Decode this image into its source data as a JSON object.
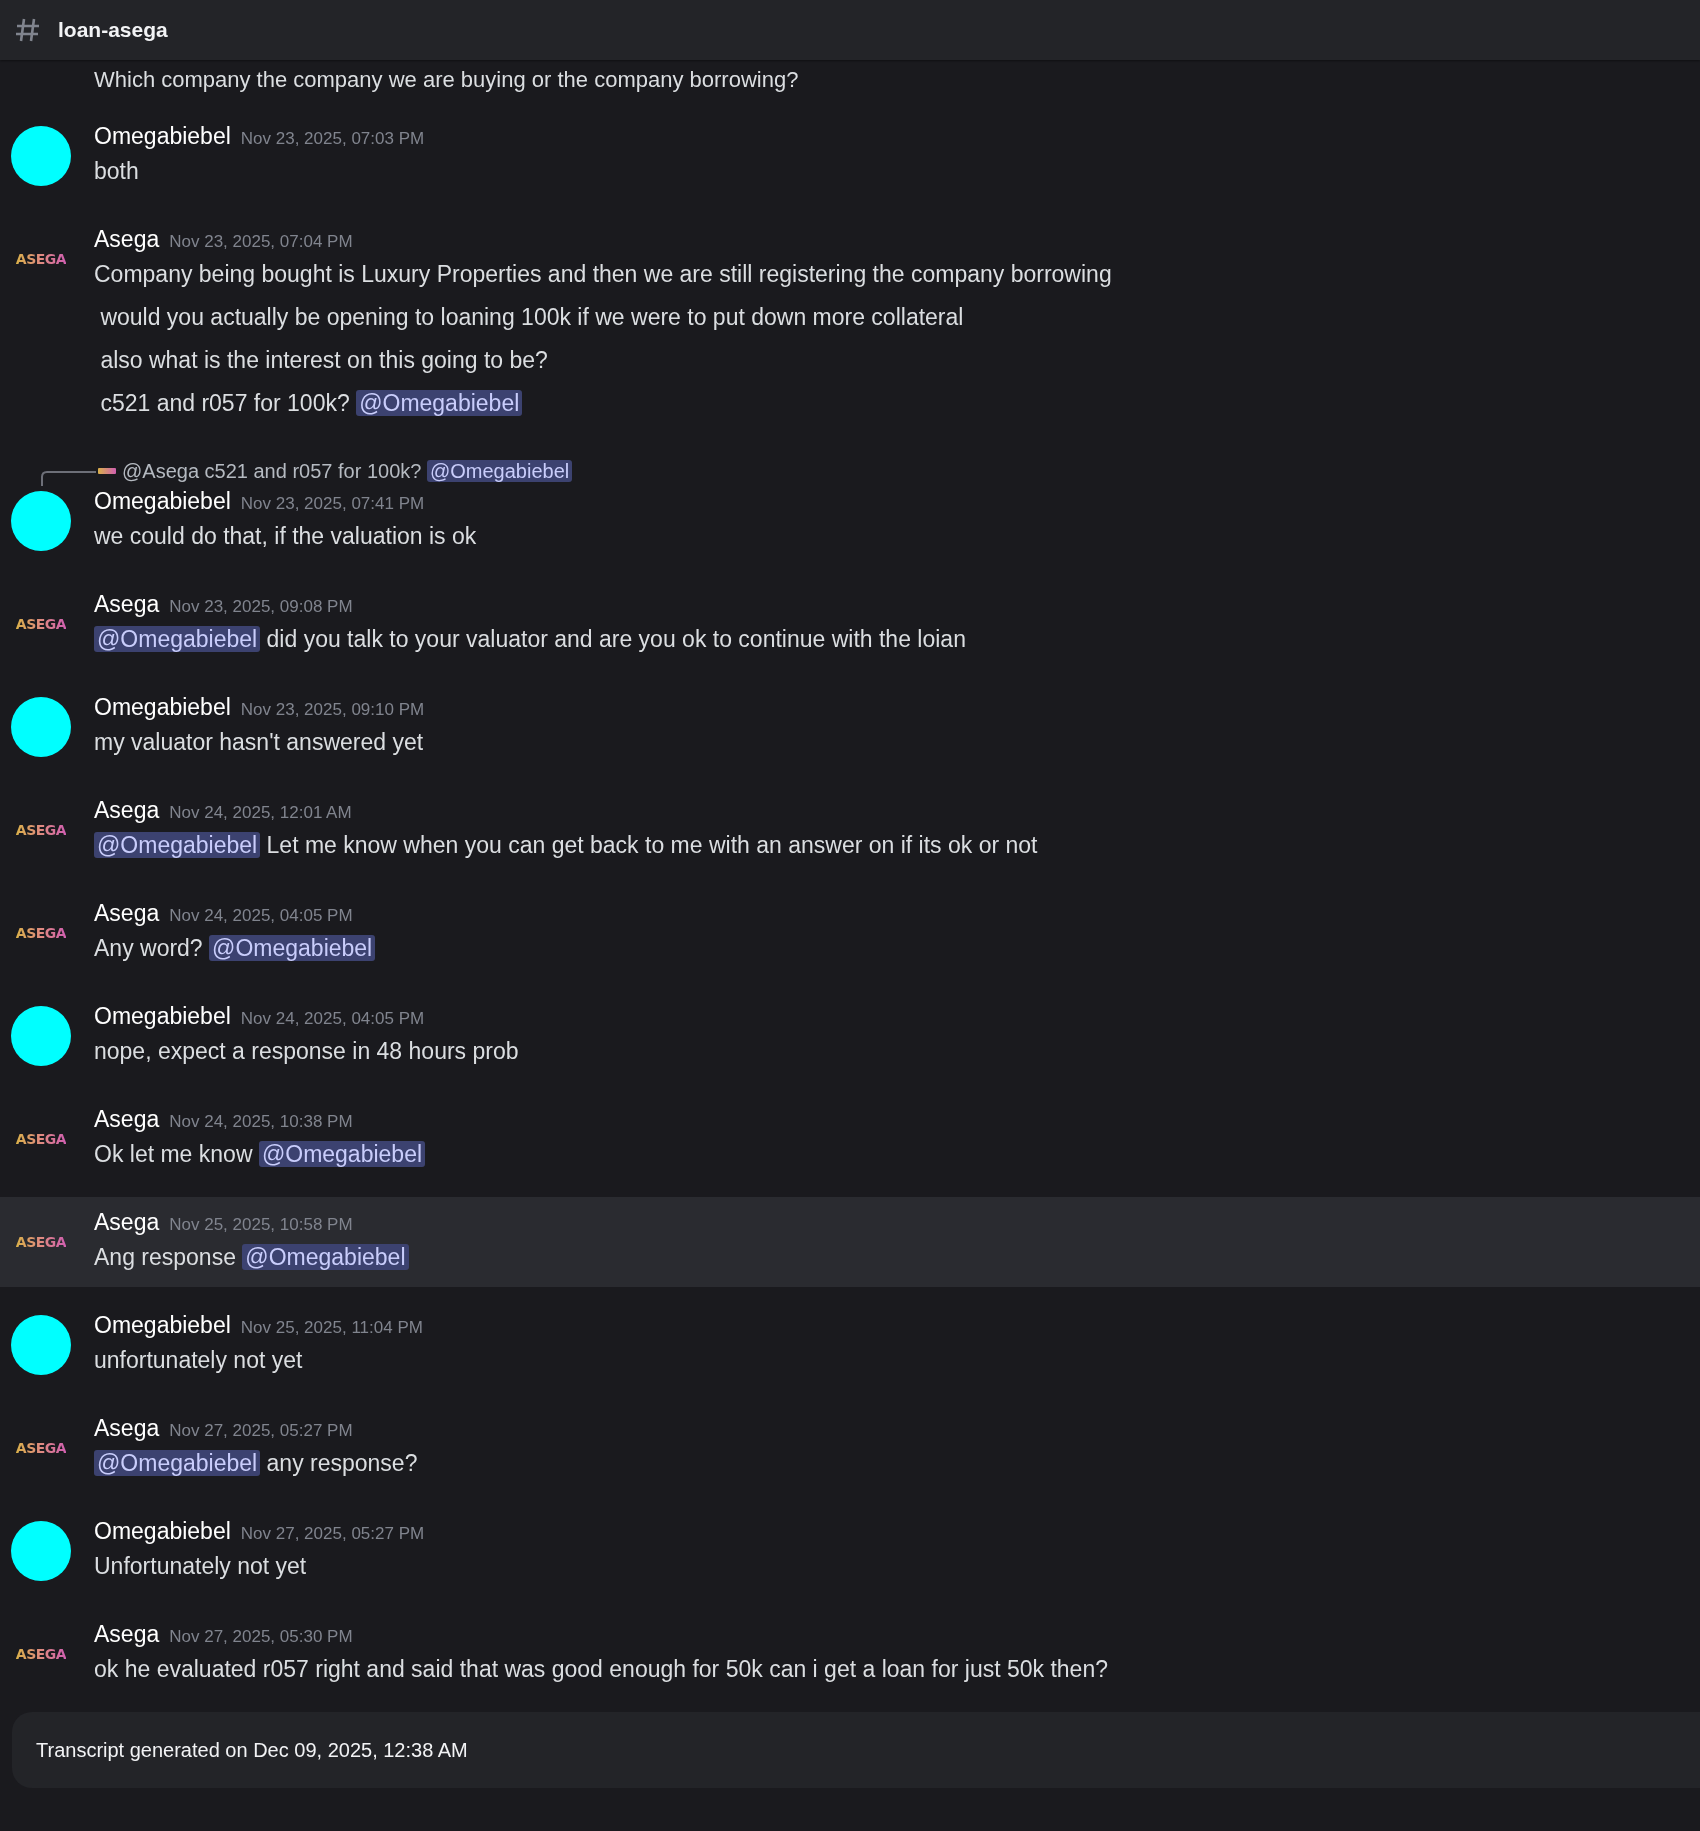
{
  "channel": {
    "name": "loan-asega"
  },
  "partial_message": "Which company the company we are buying or the company borrowing?",
  "messages": [
    {
      "author": "Omegabiebel",
      "kind": "circle",
      "timestamp": "Nov 23, 2025, 07:03 PM",
      "highlighted": false,
      "lines": [
        [
          {
            "kind": "text",
            "text": "both"
          }
        ]
      ]
    },
    {
      "author": "Asega",
      "kind": "logo",
      "avatar_text": "ASEGA",
      "timestamp": "Nov 23, 2025, 07:04 PM",
      "highlighted": false,
      "lines": [
        [
          {
            "kind": "text",
            "text": "Company being bought is Luxury Properties and then we are still registering the company borrowing"
          }
        ],
        [
          {
            "kind": "text",
            "text": " would you actually be opening to loaning 100k if we were to put down more collateral"
          }
        ],
        [
          {
            "kind": "text",
            "text": " also what is the interest on this going to be?"
          }
        ],
        [
          {
            "kind": "text",
            "text": " c521 and r057 for 100k? "
          },
          {
            "kind": "mention",
            "text": "@Omegabiebel"
          }
        ]
      ]
    },
    {
      "author": "Omegabiebel",
      "kind": "circle",
      "timestamp": "Nov 23, 2025, 07:41 PM",
      "highlighted": false,
      "reply": [
        {
          "kind": "text",
          "text": "@Asega c521 and r057 for 100k? "
        },
        {
          "kind": "mention",
          "text": "@Omegabiebel"
        }
      ],
      "lines": [
        [
          {
            "kind": "text",
            "text": "we could do that, if the valuation is ok"
          }
        ]
      ]
    },
    {
      "author": "Asega",
      "kind": "logo",
      "avatar_text": "ASEGA",
      "timestamp": "Nov 23, 2025, 09:08 PM",
      "highlighted": false,
      "lines": [
        [
          {
            "kind": "mention",
            "text": "@Omegabiebel"
          },
          {
            "kind": "text",
            "text": " did you talk to your valuator and are you ok to continue with the loian"
          }
        ]
      ]
    },
    {
      "author": "Omegabiebel",
      "kind": "circle",
      "timestamp": "Nov 23, 2025, 09:10 PM",
      "highlighted": false,
      "lines": [
        [
          {
            "kind": "text",
            "text": "my valuator hasn't answered yet"
          }
        ]
      ]
    },
    {
      "author": "Asega",
      "kind": "logo",
      "avatar_text": "ASEGA",
      "timestamp": "Nov 24, 2025, 12:01 AM",
      "highlighted": false,
      "lines": [
        [
          {
            "kind": "mention",
            "text": "@Omegabiebel"
          },
          {
            "kind": "text",
            "text": " Let me know when you can get back to me with an answer on if its ok or not"
          }
        ]
      ]
    },
    {
      "author": "Asega",
      "kind": "logo",
      "avatar_text": "ASEGA",
      "timestamp": "Nov 24, 2025, 04:05 PM",
      "highlighted": false,
      "lines": [
        [
          {
            "kind": "text",
            "text": "Any word? "
          },
          {
            "kind": "mention",
            "text": "@Omegabiebel"
          }
        ]
      ]
    },
    {
      "author": "Omegabiebel",
      "kind": "circle",
      "timestamp": "Nov 24, 2025, 04:05 PM",
      "highlighted": false,
      "lines": [
        [
          {
            "kind": "text",
            "text": "nope, expect a response in 48 hours prob"
          }
        ]
      ]
    },
    {
      "author": "Asega",
      "kind": "logo",
      "avatar_text": "ASEGA",
      "timestamp": "Nov 24, 2025, 10:38 PM",
      "highlighted": false,
      "lines": [
        [
          {
            "kind": "text",
            "text": "Ok let me know "
          },
          {
            "kind": "mention",
            "text": "@Omegabiebel"
          }
        ]
      ]
    },
    {
      "author": "Asega",
      "kind": "logo",
      "avatar_text": "ASEGA",
      "timestamp": "Nov 25, 2025, 10:58 PM",
      "highlighted": true,
      "lines": [
        [
          {
            "kind": "text",
            "text": "Ang response "
          },
          {
            "kind": "mention",
            "text": "@Omegabiebel"
          }
        ]
      ]
    },
    {
      "author": "Omegabiebel",
      "kind": "circle",
      "timestamp": "Nov 25, 2025, 11:04 PM",
      "highlighted": false,
      "lines": [
        [
          {
            "kind": "text",
            "text": "unfortunately not yet"
          }
        ]
      ]
    },
    {
      "author": "Asega",
      "kind": "logo",
      "avatar_text": "ASEGA",
      "timestamp": "Nov 27, 2025, 05:27 PM",
      "highlighted": false,
      "lines": [
        [
          {
            "kind": "mention",
            "text": "@Omegabiebel"
          },
          {
            "kind": "text",
            "text": " any response?"
          }
        ]
      ]
    },
    {
      "author": "Omegabiebel",
      "kind": "circle",
      "timestamp": "Nov 27, 2025, 05:27 PM",
      "highlighted": false,
      "lines": [
        [
          {
            "kind": "text",
            "text": "Unfortunately not yet"
          }
        ]
      ]
    },
    {
      "author": "Asega",
      "kind": "logo",
      "avatar_text": "ASEGA",
      "timestamp": "Nov 27, 2025, 05:30 PM",
      "highlighted": false,
      "lines": [
        [
          {
            "kind": "text",
            "text": "ok he evaluated r057 right and said that was good enough for 50k can i get a loan for just 50k then?"
          }
        ]
      ]
    }
  ],
  "footer": {
    "text": "Transcript generated on Dec 09, 2025, 12:38 AM"
  }
}
